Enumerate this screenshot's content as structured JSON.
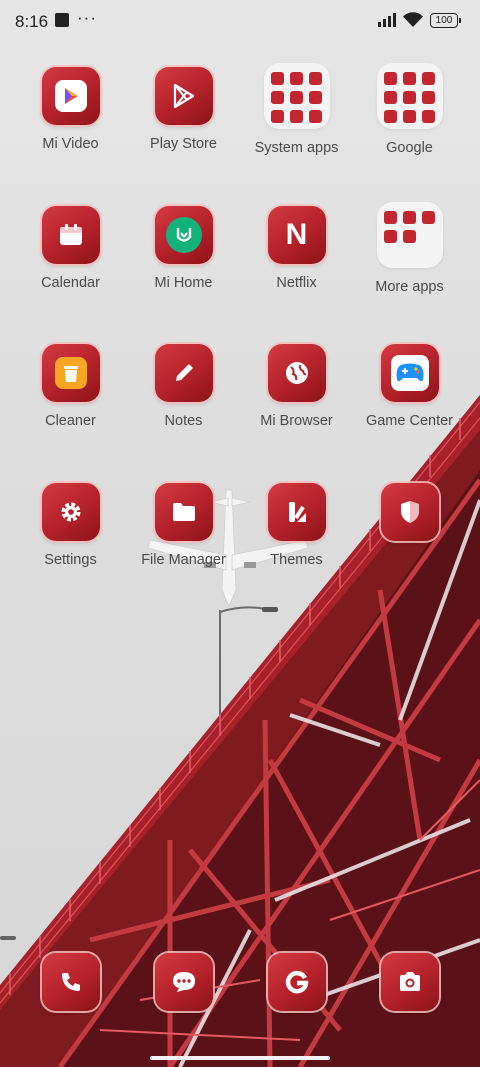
{
  "status_bar": {
    "time": "8:16",
    "more": "···",
    "battery": "100"
  },
  "apps": [
    {
      "label": "Mi Video",
      "icon": "mi-video-icon"
    },
    {
      "label": "Play Store",
      "icon": "play-store-icon"
    },
    {
      "label": "System apps",
      "icon": "folder-icon"
    },
    {
      "label": "Google",
      "icon": "folder-icon"
    },
    {
      "label": "Calendar",
      "icon": "calendar-icon"
    },
    {
      "label": "Mi Home",
      "icon": "mi-home-icon"
    },
    {
      "label": "Netflix",
      "icon": "netflix-icon"
    },
    {
      "label": "More apps",
      "icon": "folder-icon"
    },
    {
      "label": "Cleaner",
      "icon": "trash-icon"
    },
    {
      "label": "Notes",
      "icon": "pencil-icon"
    },
    {
      "label": "Mi Browser",
      "icon": "globe-icon"
    },
    {
      "label": "Game Center",
      "icon": "gamepad-icon"
    },
    {
      "label": "Settings",
      "icon": "gear-icon"
    },
    {
      "label": "File Manager",
      "icon": "folder-file-icon"
    },
    {
      "label": "Themes",
      "icon": "themes-icon"
    },
    {
      "label": "",
      "icon": "shield-icon"
    }
  ],
  "netflix_letter": "N",
  "dock": [
    {
      "icon": "phone-icon"
    },
    {
      "icon": "message-icon"
    },
    {
      "icon": "google-g-icon"
    },
    {
      "icon": "camera-icon"
    }
  ],
  "colors": {
    "accent": "#c22630",
    "icon_border": "#f4c0c0",
    "label": "#4a4a4a"
  }
}
